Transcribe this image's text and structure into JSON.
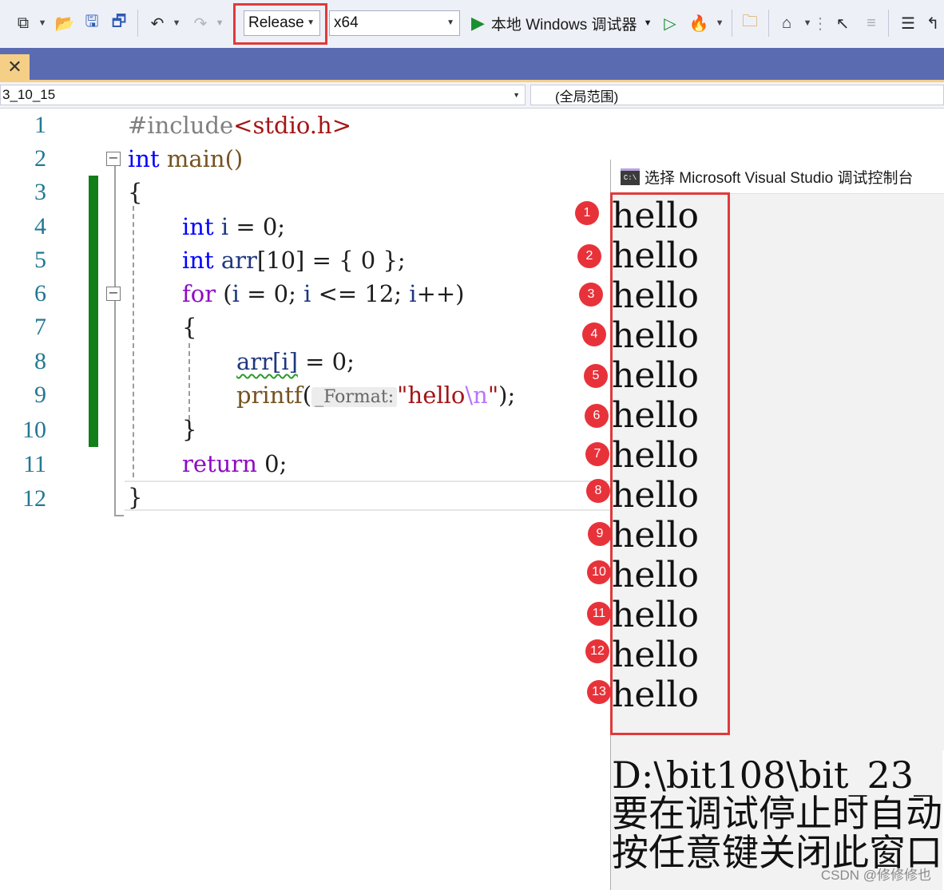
{
  "toolbar": {
    "config": "Release",
    "platform": "x64",
    "run_label": "本地 Windows 调试器",
    "icons": [
      "new-project-icon",
      "open-folder-icon",
      "save-icon",
      "save-all-icon",
      "undo-icon",
      "redo-icon",
      "start-without-debug-icon",
      "hot-reload-icon",
      "solution-explorer-icon",
      "window-layout-icon",
      "cursor-icon",
      "comment-icon",
      "uncomment-icon",
      "indent-icon",
      "outdent-icon"
    ]
  },
  "tab": {
    "close_glyph": "✕"
  },
  "navbar": {
    "project": "3_10_15",
    "scope": "(全局范围)"
  },
  "editor": {
    "line_numbers": [
      "1",
      "2",
      "3",
      "4",
      "5",
      "6",
      "7",
      "8",
      "9",
      "10",
      "11",
      "12"
    ],
    "lines": {
      "l1a": "#include",
      "l1b": "<stdio.h>",
      "l2a": "int",
      "l2b": " main()",
      "l3": "{",
      "l4a": "int",
      "l4b": " i",
      "l4c": " = 0;",
      "l5a": "int",
      "l5b": " arr",
      "l5c": "[10] = { 0 };",
      "l6a": "for",
      "l6b": " (",
      "l6c": "i",
      "l6d": " = 0; ",
      "l6e": "i",
      "l6f": " <= 12; ",
      "l6g": "i",
      "l6h": "++)",
      "l7": "{",
      "l8a": "arr[i]",
      "l8b": " = 0;",
      "l9a": "printf",
      "l9b": "(",
      "l9hint": "_Format:",
      "l9c": "\"hello",
      "l9esc": "\\n",
      "l9d": "\"",
      "l9e": ");",
      "l10": "}",
      "l11a": "return",
      "l11b": " 0;",
      "l12": "}"
    }
  },
  "console": {
    "title": "选择 Microsoft Visual Studio 调试控制台",
    "icon_text": "C:\\",
    "output": [
      "hello",
      "hello",
      "hello",
      "hello",
      "hello",
      "hello",
      "hello",
      "hello",
      "hello",
      "hello",
      "hello",
      "hello",
      "hello"
    ],
    "badges": [
      "1",
      "2",
      "3",
      "4",
      "5",
      "6",
      "7",
      "8",
      "9",
      "10",
      "11",
      "12",
      "13"
    ],
    "path_line": "D:\\bit108\\bit_23_",
    "msg1": "要在调试停止时自动",
    "msg2": "按任意键关闭此窗口"
  },
  "watermark": "CSDN @修修修也"
}
